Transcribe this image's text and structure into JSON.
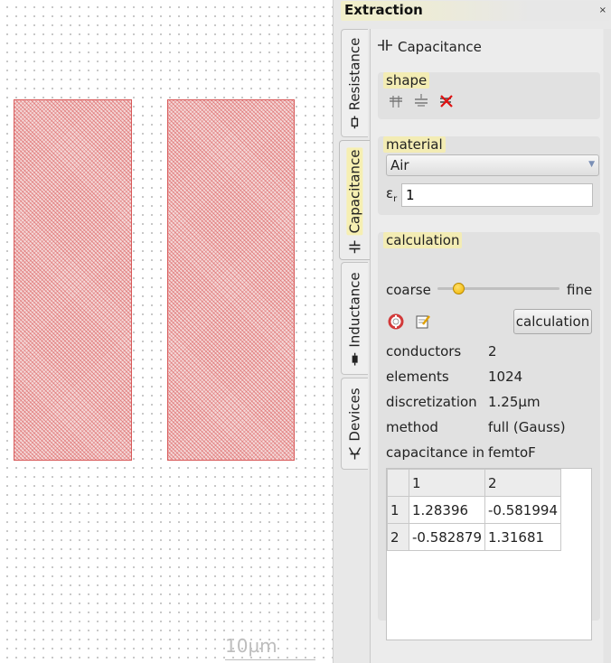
{
  "canvas": {
    "scale_label": "10µm"
  },
  "dock": {
    "title": "Extraction",
    "close_glyph": "×",
    "tabs": [
      {
        "label": "Resistance",
        "icon": "resistor-icon",
        "active": false
      },
      {
        "label": "Capacitance",
        "icon": "capacitor-icon",
        "active": true
      },
      {
        "label": "Inductance",
        "icon": "inductor-icon",
        "active": false
      },
      {
        "label": "Devices",
        "icon": "transistor-icon",
        "active": false
      }
    ],
    "header": {
      "glyph": "⊣⊢",
      "title": "Capacitance"
    },
    "shape": {
      "title": "shape",
      "tools": [
        "capacitor-top-icon",
        "capacitor-bottom-icon",
        "delete-shape-icon"
      ]
    },
    "material": {
      "title": "material",
      "selected": "Air",
      "eps_symbol": "ε",
      "eps_sub": "r",
      "eps_value": "1"
    },
    "calculation": {
      "title": "calculation",
      "coarse_label": "coarse",
      "fine_label": "fine",
      "slider_fraction": 0.14,
      "button_label": "calculation",
      "tool_icons": [
        "lifebuoy-icon",
        "notepad-icon"
      ],
      "rows": [
        {
          "label": "conductors",
          "value": "2"
        },
        {
          "label": "elements",
          "value": "1024"
        },
        {
          "label": "discretization",
          "value": "1.25µm"
        },
        {
          "label": "method",
          "value": "full (Gauss)"
        },
        {
          "label": "capacitance in",
          "value": "femtoF"
        }
      ],
      "table": {
        "col_headers": [
          "1",
          "2"
        ],
        "rows": [
          {
            "header": "1",
            "cells": [
              "1.28396",
              "-0.581994"
            ]
          },
          {
            "header": "2",
            "cells": [
              "-0.582879",
              "1.31681"
            ]
          }
        ]
      }
    }
  },
  "colors": {
    "conductor_fill": "#f4d9d9",
    "conductor_stroke": "#d85a5a",
    "highlight": "#f3ecb4",
    "slider_knob": "#f0b400"
  }
}
